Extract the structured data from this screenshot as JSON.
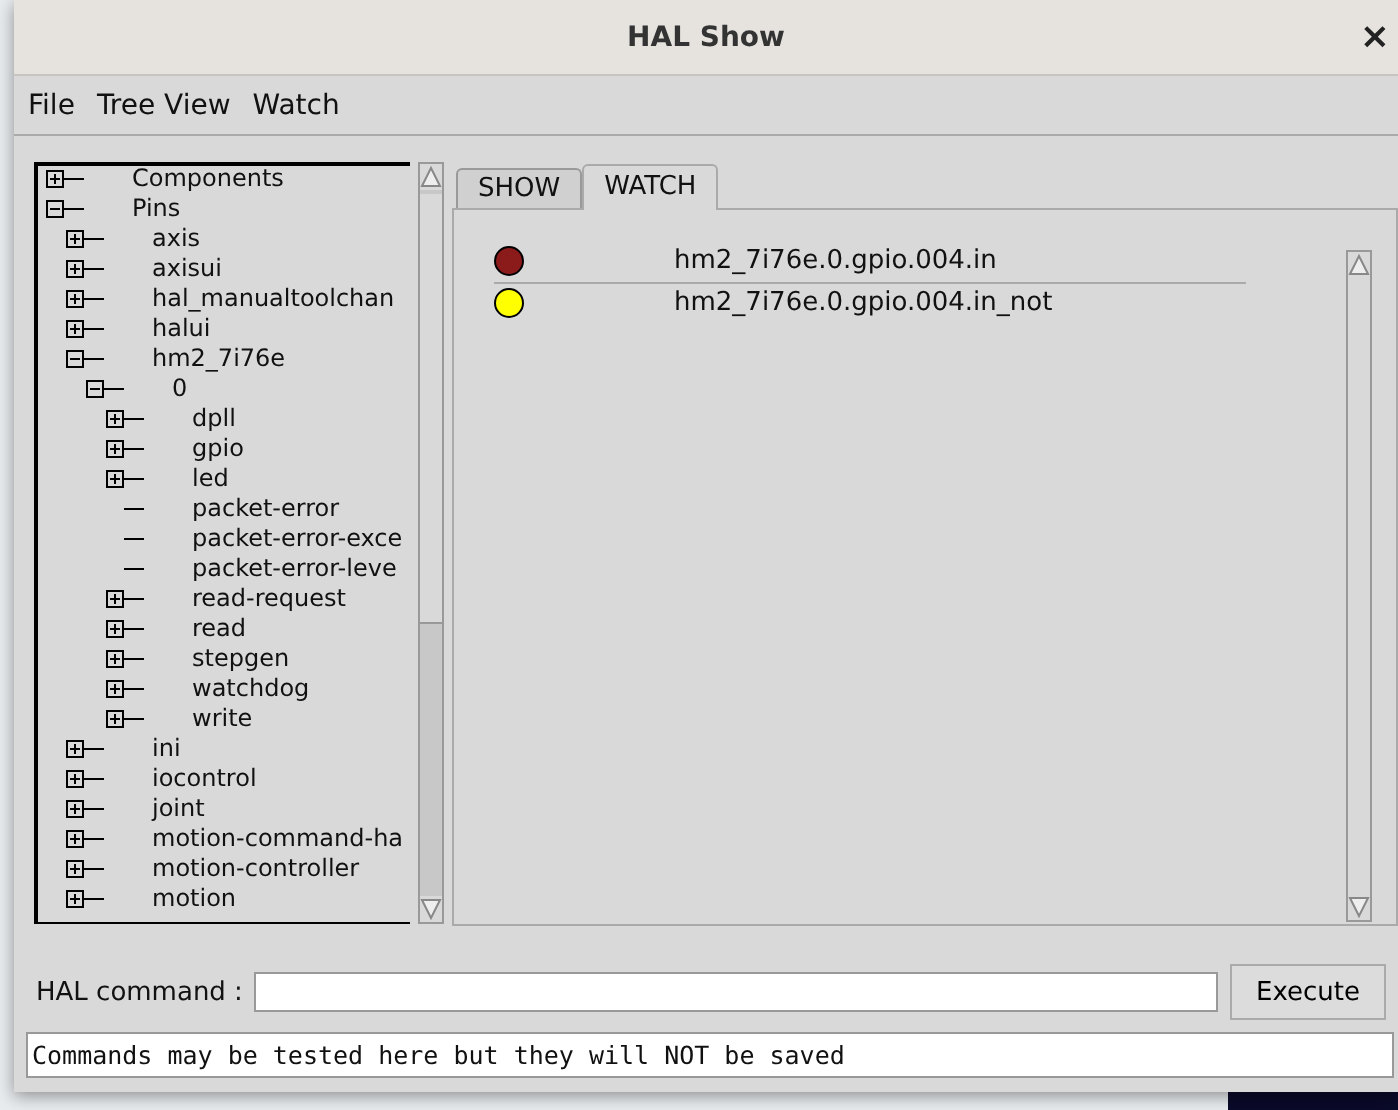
{
  "window": {
    "title": "HAL Show",
    "close": "×"
  },
  "menu": [
    "File",
    "Tree View",
    "Watch"
  ],
  "tree": [
    {
      "label": "Components",
      "expanded": false
    },
    {
      "label": "Pins",
      "expanded": true,
      "children": [
        {
          "label": "axis",
          "expanded": false
        },
        {
          "label": "axisui",
          "expanded": false
        },
        {
          "label": "hal_manualtoolchan",
          "expanded": false
        },
        {
          "label": "halui",
          "expanded": false
        },
        {
          "label": "hm2_7i76e",
          "expanded": true,
          "children": [
            {
              "label": "0",
              "expanded": true,
              "children": [
                {
                  "label": "dpll",
                  "expanded": false
                },
                {
                  "label": "gpio",
                  "expanded": false
                },
                {
                  "label": "led",
                  "expanded": false
                },
                {
                  "label": "packet-error"
                },
                {
                  "label": "packet-error-exce"
                },
                {
                  "label": "packet-error-leve"
                },
                {
                  "label": "read-request",
                  "expanded": false
                },
                {
                  "label": "read",
                  "expanded": false
                },
                {
                  "label": "stepgen",
                  "expanded": false
                },
                {
                  "label": "watchdog",
                  "expanded": false
                },
                {
                  "label": "write",
                  "expanded": false
                }
              ]
            }
          ]
        },
        {
          "label": "ini",
          "expanded": false
        },
        {
          "label": "iocontrol",
          "expanded": false
        },
        {
          "label": "joint",
          "expanded": false
        },
        {
          "label": "motion-command-ha",
          "expanded": false
        },
        {
          "label": "motion-controller",
          "expanded": false
        },
        {
          "label": "motion",
          "expanded": false
        }
      ]
    }
  ],
  "tabs": [
    {
      "label": "SHOW",
      "selected": false
    },
    {
      "label": "WATCH",
      "selected": true
    }
  ],
  "watch": [
    {
      "name": "hm2_7i76e.0.gpio.004.in",
      "color": "#8b1a1a"
    },
    {
      "name": "hm2_7i76e.0.gpio.004.in_not",
      "color": "#ffff00"
    }
  ],
  "command": {
    "label": "HAL command :",
    "button": "Execute"
  },
  "output": "Commands may be tested here but they will NOT be saved"
}
